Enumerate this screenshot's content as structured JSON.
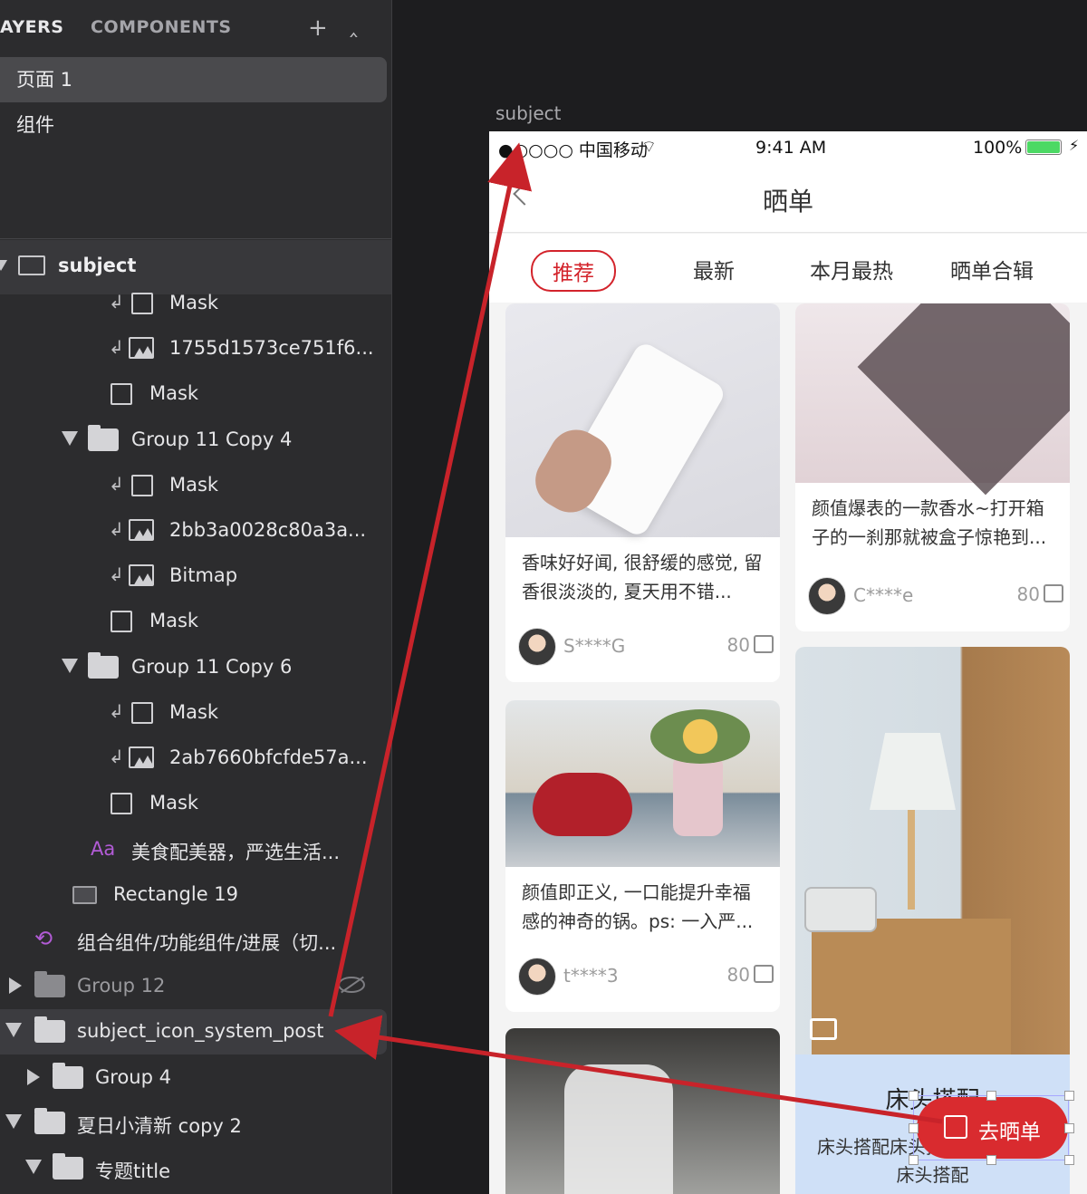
{
  "sidebar": {
    "tab_layers": "AYERS",
    "tab_components": "COMPONENTS",
    "pages": [
      "页面 1",
      "组件"
    ],
    "artboard": "subject",
    "layers": [
      "Mask",
      "1755d1573ce751f6...",
      "Mask",
      "Group 11 Copy 4",
      "Mask",
      "2bb3a0028c80a3a...",
      "Bitmap",
      "Mask",
      "Group 11 Copy 6",
      "Mask",
      "2ab7660bfcfde57a...",
      "Mask",
      "美食配美器，严选生活...",
      "Rectangle 19",
      "组合组件/功能组件/进展（切...",
      "Group 12",
      "subject_icon_system_post",
      "Group 4",
      "夏日小清新 copy 2",
      "专题title"
    ],
    "text_layer_icon": "Aa"
  },
  "canvas": {
    "artboard_title": "subject"
  },
  "phone": {
    "status": {
      "carrier": "●○○○○ 中国移动",
      "time": "9:41 AM",
      "battery": "100%"
    },
    "nav_title": "晒单",
    "tabs": [
      "推荐",
      "最新",
      "本月最热",
      "晒单合辑"
    ],
    "cards": [
      {
        "desc": "香味好好闻, 很舒缓的感觉, 留香很淡淡的, 夏天用不错...",
        "user": "S****G",
        "likes": "80"
      },
      {
        "desc": "颜值爆表的一款香水~打开箱子的一刹那就被盒子惊艳到...",
        "user": "C****e",
        "likes": "80"
      },
      {
        "desc": "颜值即正义, 一口能提升幸福感的神奇的锅。ps: 一入严...",
        "user": "t****3",
        "likes": "80"
      },
      {
        "title": "床头搭配",
        "desc": "床头搭配床头搭配",
        "sub": "床头搭配"
      }
    ],
    "fab_label": "去晒单"
  },
  "colors": {
    "accent": "#d3232b",
    "annotation_arrow": "#c8232a",
    "sidebar_bg": "#2c2c2e"
  }
}
